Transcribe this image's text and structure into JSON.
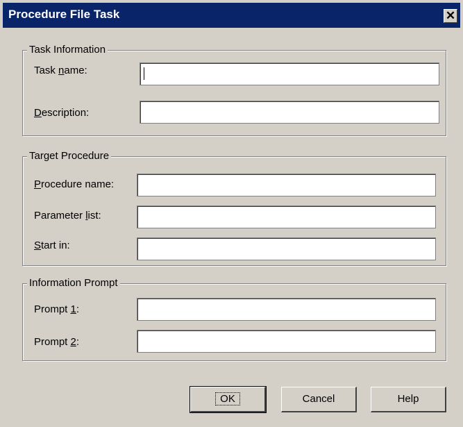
{
  "window": {
    "title": "Procedure File Task",
    "close_symbol": "✕"
  },
  "task_information": {
    "legend": "Task Information",
    "task_name": {
      "label_pre": "Task ",
      "label_key": "n",
      "label_post": "ame:",
      "value": ""
    },
    "description": {
      "label_pre": "",
      "label_key": "D",
      "label_post": "escription:",
      "value": ""
    }
  },
  "target_procedure": {
    "legend": "Target Procedure",
    "procedure_name": {
      "label_pre": "",
      "label_key": "P",
      "label_post": "rocedure name:",
      "value": ""
    },
    "parameter_list": {
      "label_pre": "Parameter ",
      "label_key": "l",
      "label_post": "ist:",
      "value": ""
    },
    "start_in": {
      "label_pre": "",
      "label_key": "S",
      "label_post": "tart in:",
      "value": ""
    }
  },
  "information_prompt": {
    "legend": "Information Prompt",
    "prompt_1": {
      "label_pre": "Prompt ",
      "label_key": "1",
      "label_post": ":",
      "value": ""
    },
    "prompt_2": {
      "label_pre": "Prompt ",
      "label_key": "2",
      "label_post": ":",
      "value": ""
    }
  },
  "buttons": {
    "ok": "OK",
    "cancel": "Cancel",
    "help": "Help"
  }
}
